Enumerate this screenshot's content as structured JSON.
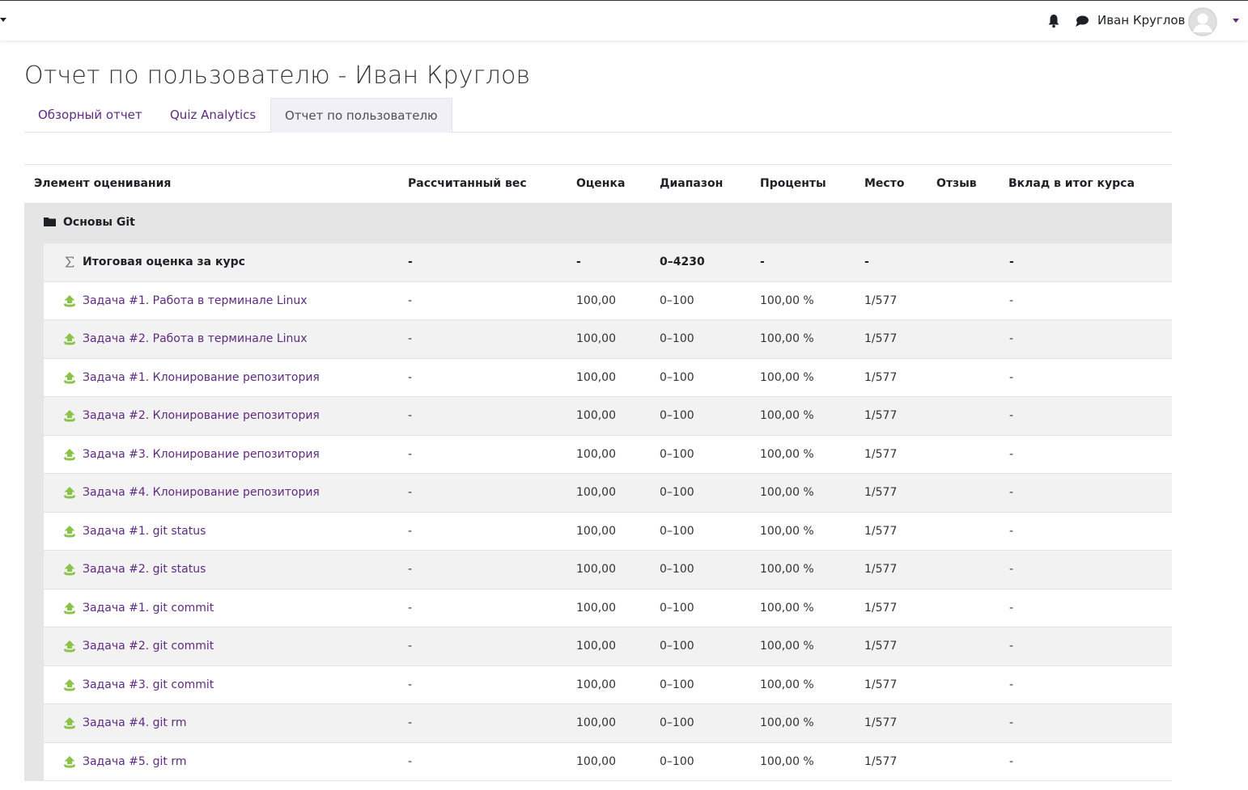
{
  "navbar": {
    "username": "Иван Круглов",
    "icons": [
      "bell-icon",
      "chat-icon",
      "avatar",
      "chevron-down-icon"
    ]
  },
  "page": {
    "title": "Отчет по пользователю - Иван Круглов"
  },
  "tabs": [
    {
      "label": "Обзорный отчет",
      "active": false
    },
    {
      "label": "Quiz Analytics",
      "active": false
    },
    {
      "label": "Отчет по пользователю",
      "active": true
    }
  ],
  "table": {
    "headers": {
      "item": "Элемент оценивания",
      "weight": "Рассчитанный вес",
      "grade": "Оценка",
      "range": "Диапазон",
      "percent": "Проценты",
      "rank": "Место",
      "feedback": "Отзыв",
      "contribution": "Вклад в итог курса"
    },
    "category": "Основы Git",
    "total": {
      "name": "Итоговая оценка за курс",
      "weight": "-",
      "grade": "-",
      "range": "0–4230",
      "percent": "-",
      "rank": "-",
      "feedback": "",
      "contribution": "-"
    },
    "rows": [
      {
        "name": "Задача #1. Работа в терминале Linux",
        "weight": "-",
        "grade": "100,00",
        "range": "0–100",
        "percent": "100,00 %",
        "rank": "1/577",
        "feedback": "",
        "contribution": "-"
      },
      {
        "name": "Задача #2. Работа в терминале Linux",
        "weight": "-",
        "grade": "100,00",
        "range": "0–100",
        "percent": "100,00 %",
        "rank": "1/577",
        "feedback": "",
        "contribution": "-"
      },
      {
        "name": "Задача #1. Клонирование репозитория",
        "weight": "-",
        "grade": "100,00",
        "range": "0–100",
        "percent": "100,00 %",
        "rank": "1/577",
        "feedback": "",
        "contribution": "-"
      },
      {
        "name": "Задача #2. Клонирование репозитория",
        "weight": "-",
        "grade": "100,00",
        "range": "0–100",
        "percent": "100,00 %",
        "rank": "1/577",
        "feedback": "",
        "contribution": "-"
      },
      {
        "name": "Задача #3. Клонирование репозитория",
        "weight": "-",
        "grade": "100,00",
        "range": "0–100",
        "percent": "100,00 %",
        "rank": "1/577",
        "feedback": "",
        "contribution": "-"
      },
      {
        "name": "Задача #4. Клонирование репозитория",
        "weight": "-",
        "grade": "100,00",
        "range": "0–100",
        "percent": "100,00 %",
        "rank": "1/577",
        "feedback": "",
        "contribution": "-"
      },
      {
        "name": "Задача #1. git status",
        "weight": "-",
        "grade": "100,00",
        "range": "0–100",
        "percent": "100,00 %",
        "rank": "1/577",
        "feedback": "",
        "contribution": "-"
      },
      {
        "name": "Задача #2. git status",
        "weight": "-",
        "grade": "100,00",
        "range": "0–100",
        "percent": "100,00 %",
        "rank": "1/577",
        "feedback": "",
        "contribution": "-"
      },
      {
        "name": "Задача #1. git commit",
        "weight": "-",
        "grade": "100,00",
        "range": "0–100",
        "percent": "100,00 %",
        "rank": "1/577",
        "feedback": "",
        "contribution": "-"
      },
      {
        "name": "Задача #2. git commit",
        "weight": "-",
        "grade": "100,00",
        "range": "0–100",
        "percent": "100,00 %",
        "rank": "1/577",
        "feedback": "",
        "contribution": "-"
      },
      {
        "name": "Задача #3. git commit",
        "weight": "-",
        "grade": "100,00",
        "range": "0–100",
        "percent": "100,00 %",
        "rank": "1/577",
        "feedback": "",
        "contribution": "-"
      },
      {
        "name": "Задача #4. git rm",
        "weight": "-",
        "grade": "100,00",
        "range": "0–100",
        "percent": "100,00 %",
        "rank": "1/577",
        "feedback": "",
        "contribution": "-"
      },
      {
        "name": "Задача #5. git rm",
        "weight": "-",
        "grade": "100,00",
        "range": "0–100",
        "percent": "100,00 %",
        "rank": "1/577",
        "feedback": "",
        "contribution": "-"
      }
    ]
  },
  "colors": {
    "link": "#5e2a82",
    "assignment_icon": "#8bc34a",
    "category_bg": "#e5e5e5"
  }
}
